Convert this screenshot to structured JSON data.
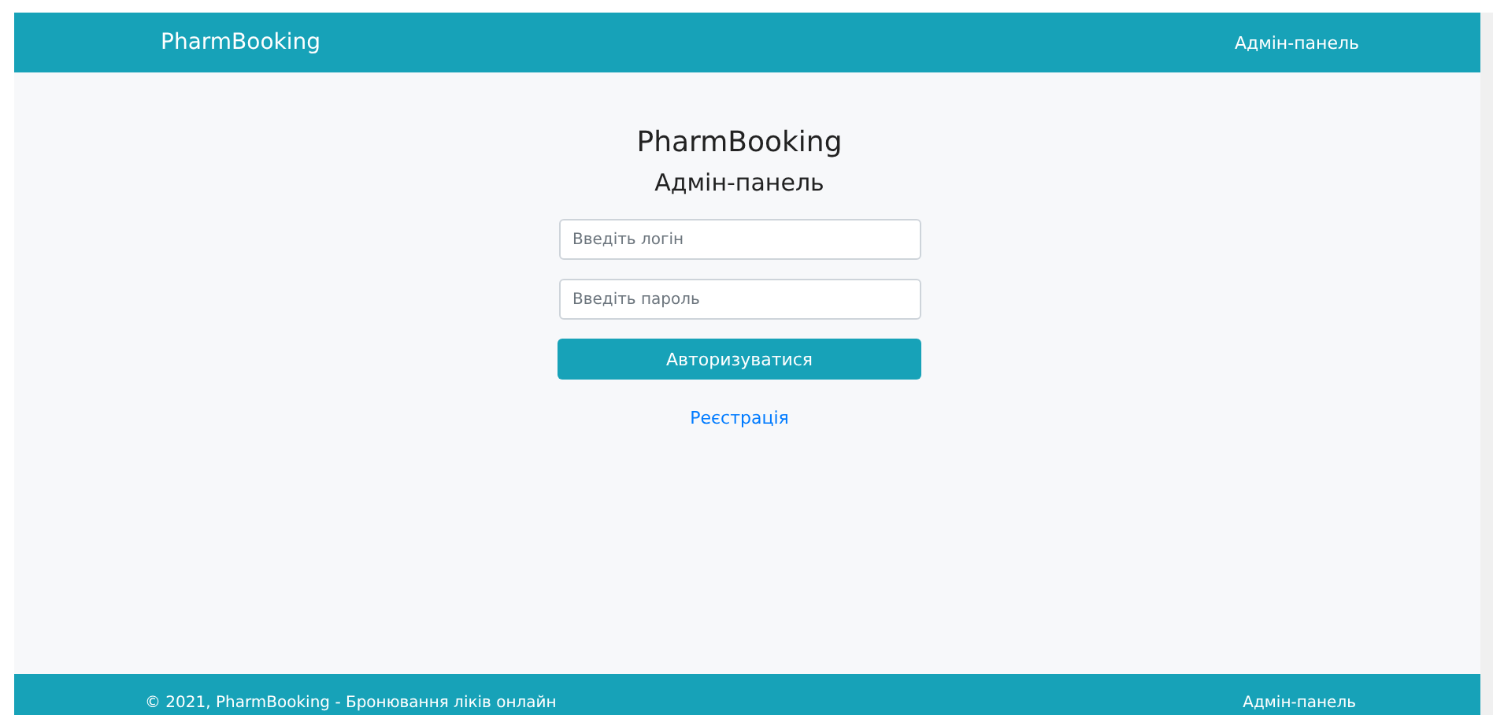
{
  "navbar": {
    "brand": "PharmBooking",
    "link": "Адмін-панель"
  },
  "login": {
    "title": "PharmBooking",
    "subtitle": "Адмін-панель",
    "fields": [
      {
        "placeholder": "Введіть логін"
      },
      {
        "placeholder": "Введіть пароль"
      }
    ],
    "submit": "Авторизуватися",
    "register_link": "Реєстрація"
  },
  "footer": {
    "copyright": "© 2021, PharmBooking - Бронювання ліків онлайн",
    "link": "Адмін-панель"
  }
}
